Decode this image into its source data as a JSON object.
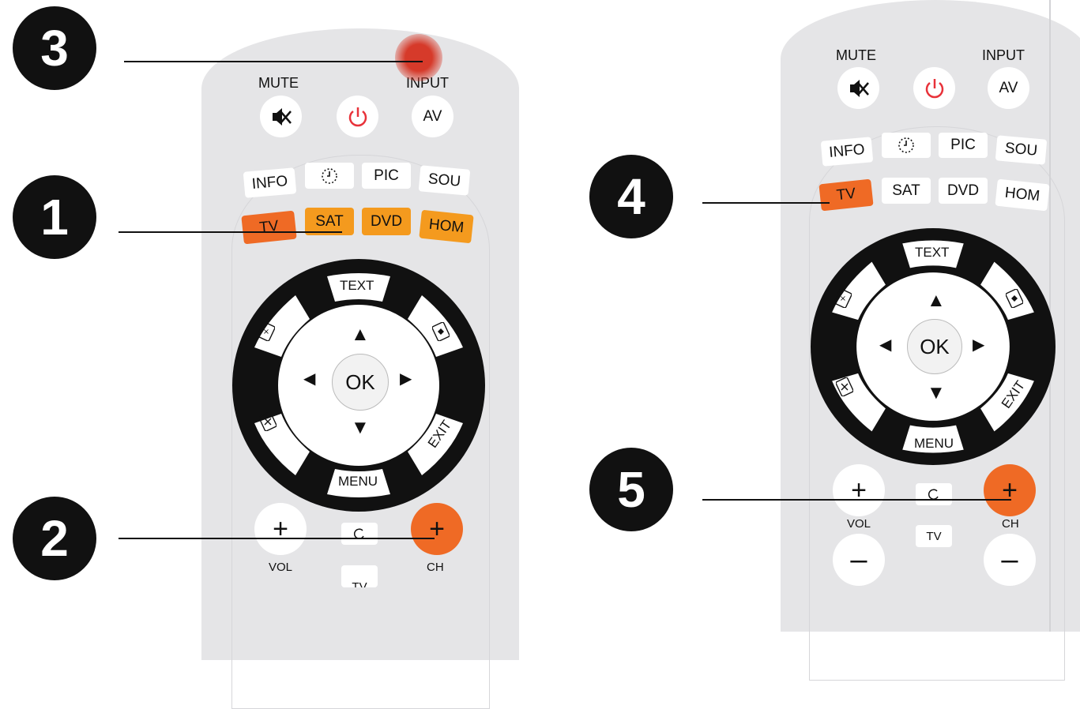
{
  "callouts": [
    "3",
    "1",
    "2",
    "4",
    "5"
  ],
  "top_buttons": {
    "mute": "MUTE",
    "input": "INPUT",
    "av": "AV"
  },
  "mode_keys": [
    "INFO",
    "PIC",
    "SOU"
  ],
  "source_keys": [
    "TV",
    "SAT",
    "DVD",
    "HOM"
  ],
  "dpad": {
    "top": "TEXT",
    "bottom": "MENU",
    "right_bottom": "EXIT",
    "ok": "OK"
  },
  "bottom": {
    "vol": "VOL",
    "ch": "CH",
    "tv": "TV",
    "plus": "+",
    "minus": "–"
  },
  "arrows": {
    "up": "▲",
    "down": "▼",
    "left": "◀",
    "right": "▶"
  },
  "colors": {
    "orange": "#f49a1e",
    "tv_active": "#ef6a25",
    "ch_plus": "#ef6a25",
    "power": "#e8323a",
    "glow": "#d63a2a"
  }
}
